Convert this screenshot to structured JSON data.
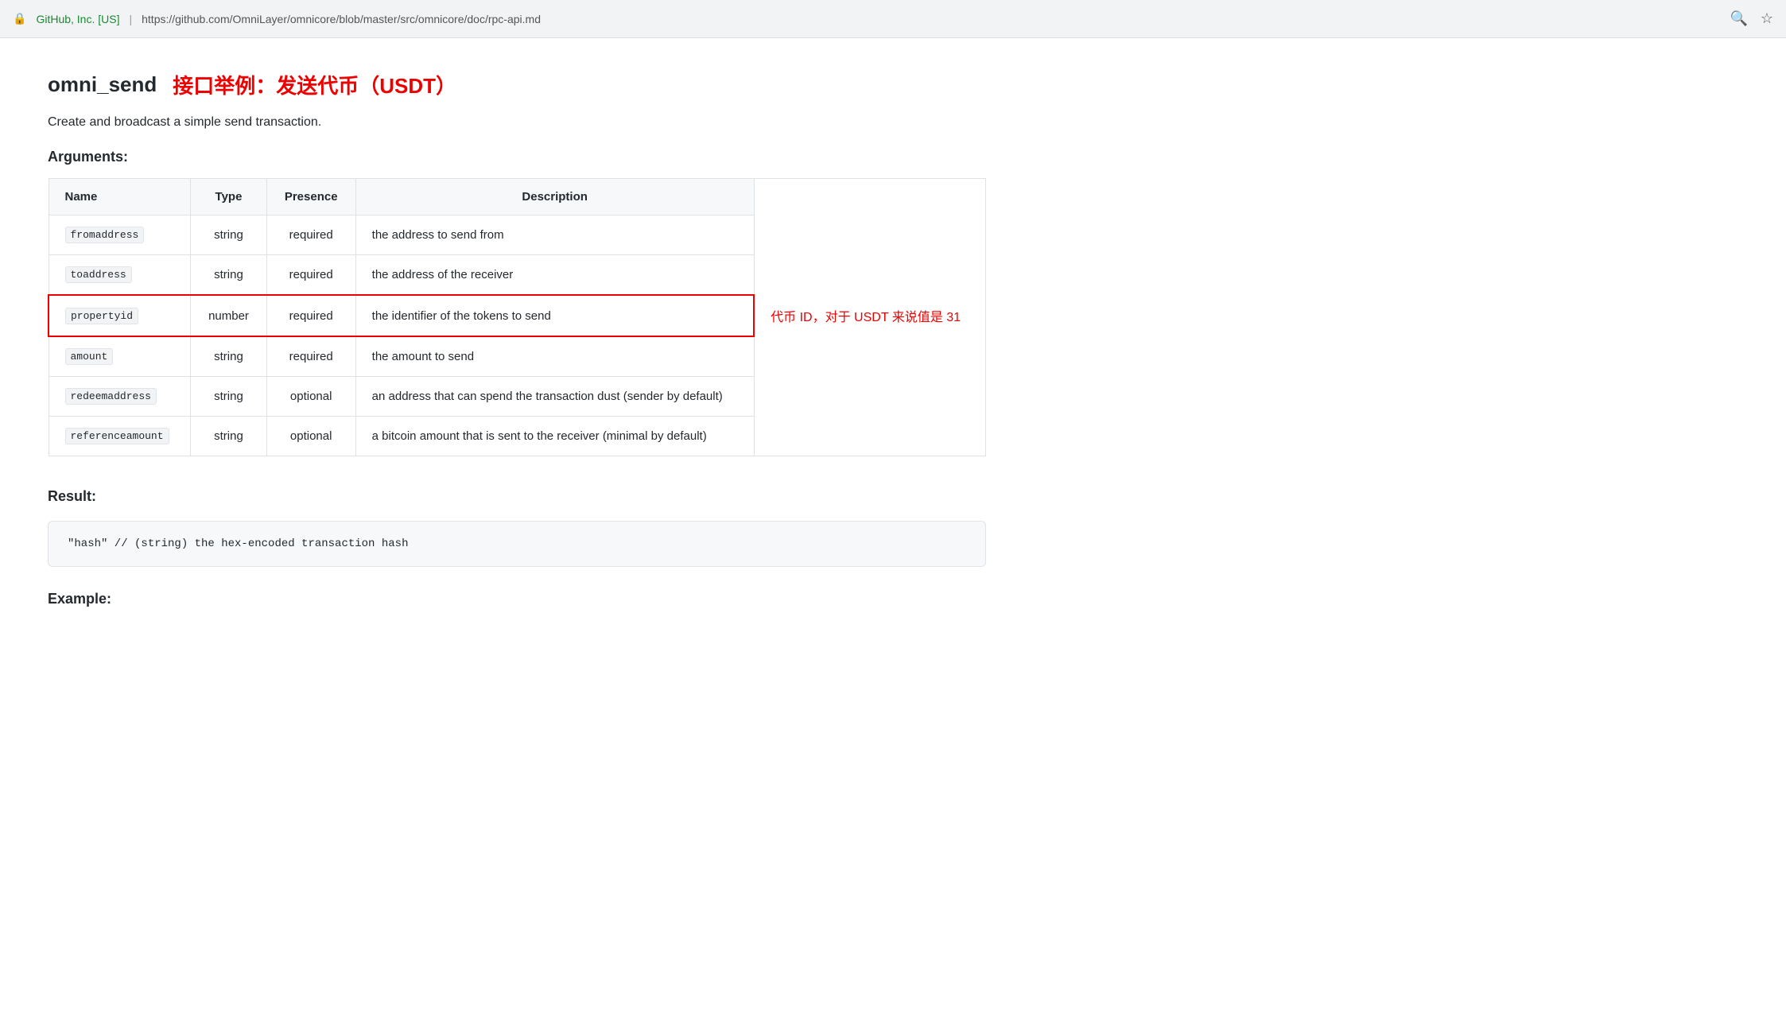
{
  "browser": {
    "lock_label": "🔒",
    "origin": "GitHub, Inc. [US]",
    "separator": "|",
    "url": "https://github.com/OmniLayer/omnicore/blob/master/src/omnicore/doc/rpc-api.md",
    "search_icon": "🔍",
    "star_icon": "☆"
  },
  "page": {
    "title": "omni_send",
    "subtitle": "接口举例：发送代币（USDT）",
    "description": "Create and broadcast a simple send transaction.",
    "arguments_label": "Arguments:",
    "result_label": "Result:",
    "example_label": "Example:"
  },
  "table": {
    "headers": [
      "Name",
      "Type",
      "Presence",
      "Description"
    ],
    "rows": [
      {
        "name": "fromaddress",
        "type": "string",
        "presence": "required",
        "description": "the address to send from",
        "highlighted": false,
        "annotation": ""
      },
      {
        "name": "toaddress",
        "type": "string",
        "presence": "required",
        "description": "the address of the receiver",
        "highlighted": false,
        "annotation": ""
      },
      {
        "name": "propertyid",
        "type": "number",
        "presence": "required",
        "description": "the identifier of the tokens to send",
        "highlighted": true,
        "annotation": "代币 ID，对于 USDT 来说值是 31"
      },
      {
        "name": "amount",
        "type": "string",
        "presence": "required",
        "description": "the amount to send",
        "highlighted": false,
        "annotation": ""
      },
      {
        "name": "redeemaddress",
        "type": "string",
        "presence": "optional",
        "description": "an address that can spend the transaction dust (sender by default)",
        "highlighted": false,
        "annotation": ""
      },
      {
        "name": "referenceamount",
        "type": "string",
        "presence": "optional",
        "description": "a bitcoin amount that is sent to the receiver (minimal by default)",
        "highlighted": false,
        "annotation": ""
      }
    ]
  },
  "result": {
    "code": "\"hash\"  // (string) the hex-encoded transaction hash"
  }
}
